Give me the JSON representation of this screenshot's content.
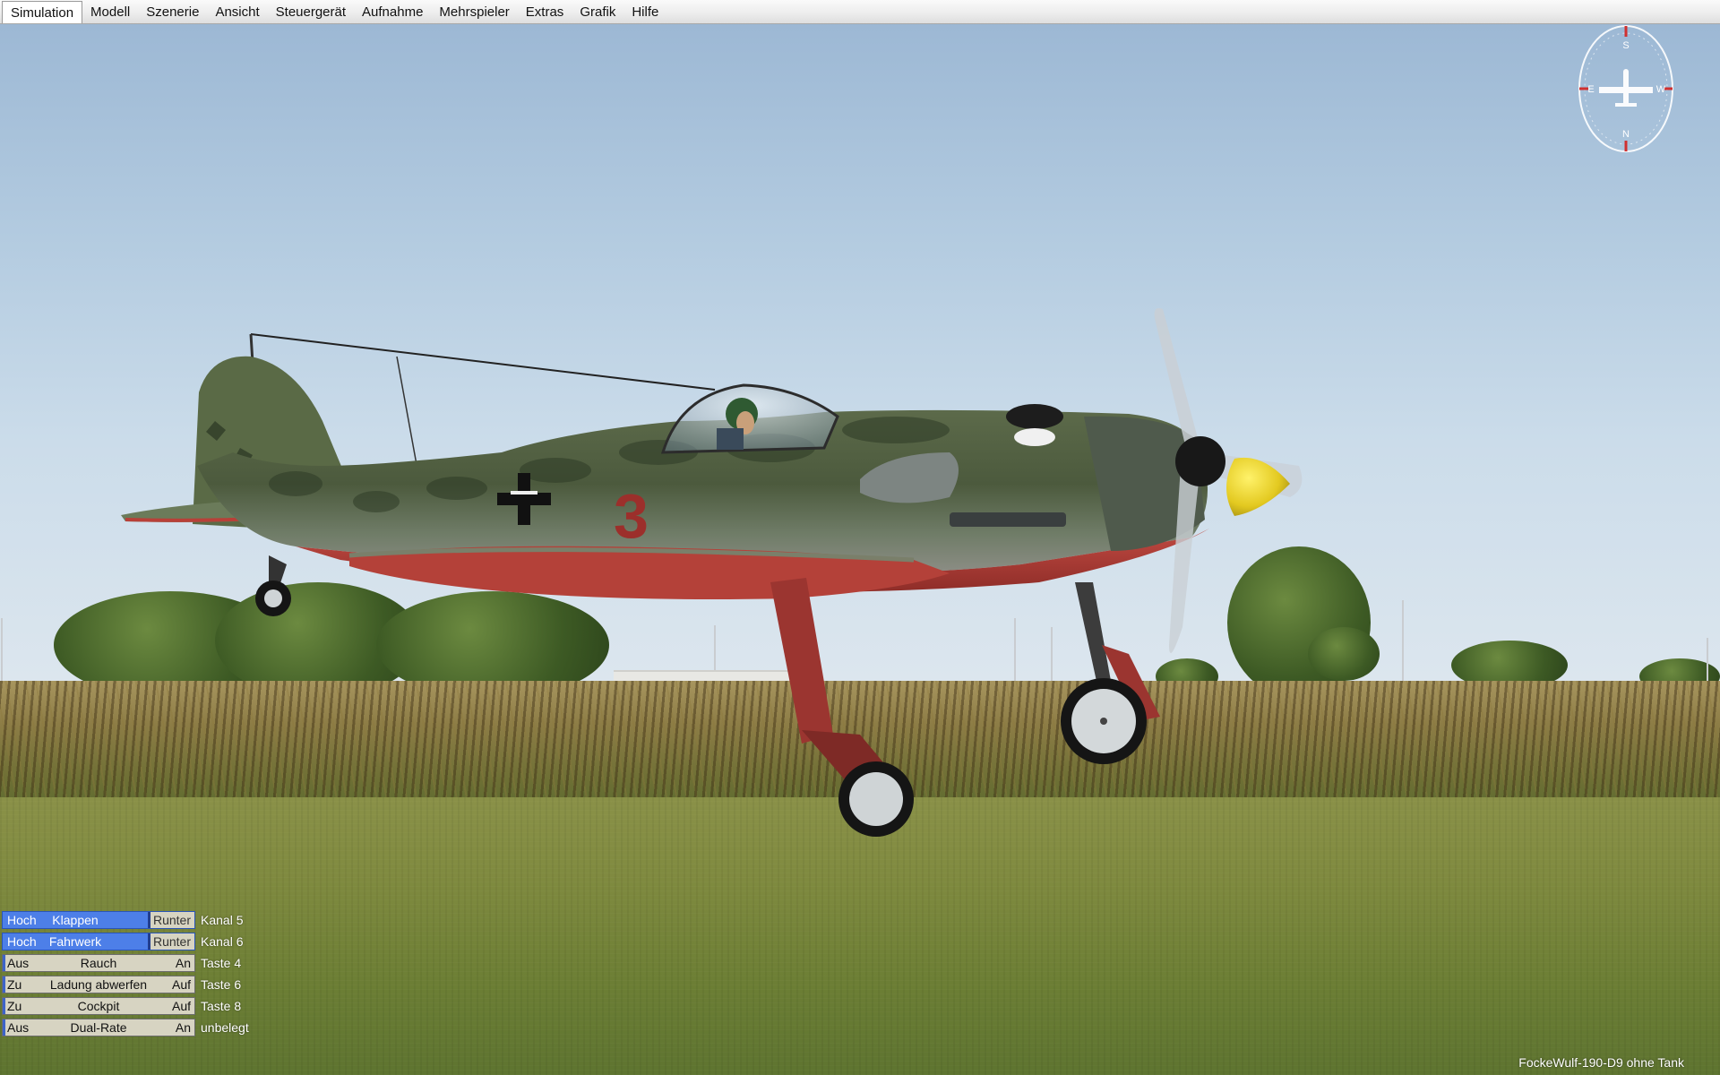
{
  "menu": {
    "items": [
      {
        "label": "Simulation",
        "active": true
      },
      {
        "label": "Modell"
      },
      {
        "label": "Szenerie"
      },
      {
        "label": "Ansicht"
      },
      {
        "label": "Steuergerät"
      },
      {
        "label": "Aufnahme"
      },
      {
        "label": "Mehrspieler"
      },
      {
        "label": "Extras"
      },
      {
        "label": "Grafik"
      },
      {
        "label": "Hilfe"
      }
    ]
  },
  "compass": {
    "letters": {
      "top": "S",
      "left": "E",
      "right": "W",
      "bottom": "N"
    },
    "icon": "airplane-icon"
  },
  "aircraft": {
    "fuselage_number": "3"
  },
  "switches": [
    {
      "left": "Hoch",
      "name": "Klappen",
      "right": "Runter",
      "assignment": "Kanal 5",
      "state": "on"
    },
    {
      "left": "Hoch",
      "name": "Fahrwerk",
      "right": "Runter",
      "assignment": "Kanal 6",
      "state": "on"
    },
    {
      "left": "Aus",
      "name": "Rauch",
      "right": "An",
      "assignment": "Taste 4",
      "state": "off"
    },
    {
      "left": "Zu",
      "name": "Ladung abwerfen",
      "right": "Auf",
      "assignment": "Taste 6",
      "state": "off"
    },
    {
      "left": "Zu",
      "name": "Cockpit",
      "right": "Auf",
      "assignment": "Taste 8",
      "state": "off"
    },
    {
      "left": "Aus",
      "name": "Dual-Rate",
      "right": "An",
      "assignment": "unbelegt",
      "state": "off"
    }
  ],
  "status": {
    "model_name": "FockeWulf-190-D9 ohne Tank"
  },
  "colors": {
    "switch_active": "#4d7fe8",
    "switch_inactive": "#d7d4c2",
    "aircraft_spinner": "#e3c920",
    "aircraft_underside": "#b23a33"
  }
}
